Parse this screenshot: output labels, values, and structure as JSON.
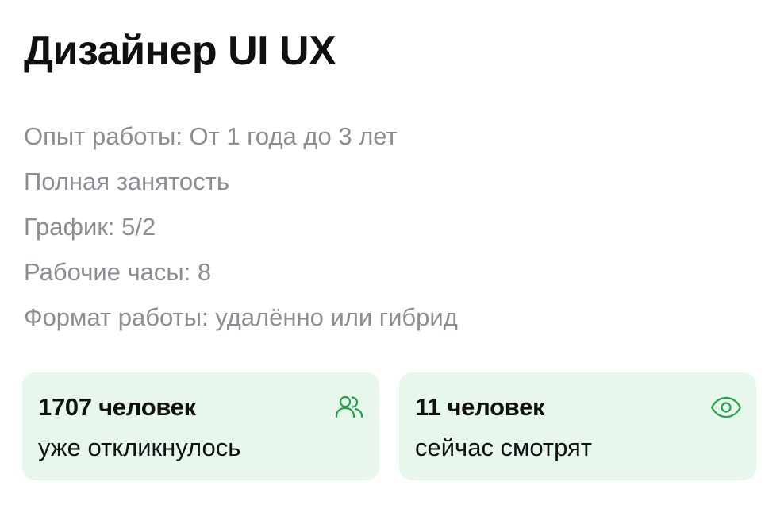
{
  "vacancy": {
    "title": "Дизайнер UI UX",
    "details": [
      "Опыт работы: От 1 года до 3 лет",
      "Полная занятость",
      "График: 5/2",
      "Рабочие часы: 8",
      "Формат работы: удалённо или гибрид"
    ]
  },
  "stats": {
    "responses": {
      "count_label": "1707 человек",
      "caption": "уже откликнулось",
      "icon": "users-icon"
    },
    "viewers": {
      "count_label": "11 человек",
      "caption": "сейчас смотрят",
      "icon": "eye-icon"
    }
  },
  "colors": {
    "card_background": "#e8f7ec",
    "icon_accent": "#1fa34a",
    "detail_text": "#8a8e93",
    "title_text": "#101010"
  }
}
